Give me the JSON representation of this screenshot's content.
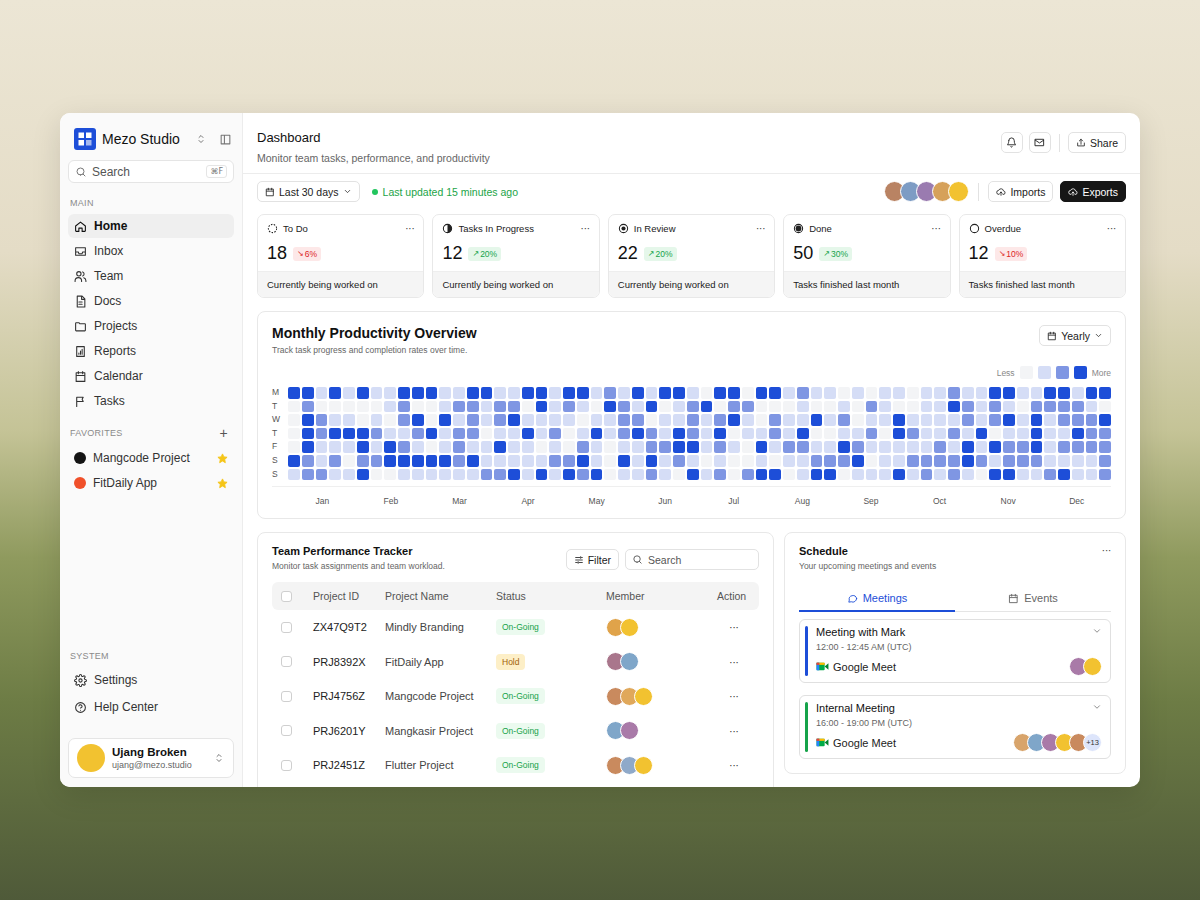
{
  "app": {
    "name": "Mezo Studio"
  },
  "search": {
    "placeholder": "Search",
    "shortcut": "⌘F"
  },
  "main_nav": {
    "label": "MAIN",
    "items": [
      {
        "label": "Home",
        "selected": true
      },
      {
        "label": "Inbox",
        "selected": false
      },
      {
        "label": "Team",
        "selected": false
      },
      {
        "label": "Docs",
        "selected": false
      },
      {
        "label": "Projects",
        "selected": false
      },
      {
        "label": "Reports",
        "selected": false
      },
      {
        "label": "Calendar",
        "selected": false
      },
      {
        "label": "Tasks",
        "selected": false
      }
    ]
  },
  "favorites": {
    "label": "FAVORITES",
    "add": "+",
    "items": [
      {
        "label": "Mangcode Project",
        "color": "#141414",
        "starred": true,
        "selected": false
      },
      {
        "label": "FitDaily App",
        "color": "#f0502a",
        "starred": true,
        "selected": false
      }
    ]
  },
  "system_nav": {
    "label": "SYSTEM",
    "items": [
      {
        "label": "Settings",
        "selected": false
      },
      {
        "label": "Help Center",
        "selected": false
      }
    ]
  },
  "user": {
    "name": "Ujang Broken",
    "email": "ujang@mezo.studio",
    "avatar_color": "#f2c230"
  },
  "header": {
    "title": "Dashboard",
    "subtitle": "Monitor team tasks, performance, and productivity",
    "share": "Share"
  },
  "toolbar": {
    "range": "Last 30 days",
    "updated": "Last updated 15 minutes ago",
    "avatars": [
      {
        "color": "#b98363"
      },
      {
        "color": "#7d9cc4"
      },
      {
        "color": "#9a7bb0"
      },
      {
        "color": "#d6a15a"
      },
      {
        "color": "#f2c230"
      }
    ],
    "imports": "Imports",
    "exports": "Exports"
  },
  "stats": [
    {
      "kind": "todo",
      "label": "To Do",
      "more": "···",
      "value": "18",
      "trend": "down",
      "arrow": "↘",
      "change": "6%",
      "note": "Currently being worked on"
    },
    {
      "kind": "progress",
      "label": "Tasks In Progress",
      "more": "···",
      "value": "12",
      "trend": "up",
      "arrow": "↗",
      "change": "20%",
      "note": "Currently being worked on"
    },
    {
      "kind": "review",
      "label": "In Review",
      "more": "···",
      "value": "22",
      "trend": "up",
      "arrow": "↗",
      "change": "20%",
      "note": "Currently being worked on"
    },
    {
      "kind": "done",
      "label": "Done",
      "more": "···",
      "value": "50",
      "trend": "up",
      "arrow": "↗",
      "change": "30%",
      "note": "Tasks finished last month"
    },
    {
      "kind": "overdue",
      "label": "Overdue",
      "more": "···",
      "value": "12",
      "trend": "down",
      "arrow": "↘",
      "change": "10%",
      "note": "Tasks finished last month"
    }
  ],
  "productivity": {
    "title": "Monthly Productivity Overview",
    "subtitle": "Track task progress and completion rates over time.",
    "period": "Yearly",
    "legend": {
      "less": "Less",
      "more": "More"
    },
    "days": [
      "M",
      "T",
      "W",
      "T",
      "F",
      "S",
      "S"
    ],
    "months": [
      "Jan",
      "Feb",
      "Mar",
      "Apr",
      "May",
      "Jun",
      "Jul",
      "Aug",
      "Sep",
      "Oct",
      "Nov",
      "Dec"
    ],
    "levels": [
      [
        3,
        3,
        1,
        3,
        1,
        3,
        1,
        1,
        3,
        3,
        3,
        1,
        1,
        3,
        3,
        1,
        1,
        3,
        3,
        1,
        3,
        3,
        1,
        2,
        1,
        3,
        1,
        3,
        3,
        1,
        0,
        3,
        3,
        0,
        3,
        3,
        1,
        2,
        1,
        1,
        0,
        1,
        0,
        1,
        1,
        0,
        1,
        1,
        2,
        1,
        1,
        3,
        3,
        1,
        1,
        3,
        3,
        1,
        3,
        3
      ],
      [
        0,
        2,
        0,
        0,
        0,
        0,
        0,
        1,
        2,
        0,
        0,
        1,
        2,
        2,
        1,
        2,
        2,
        0,
        3,
        1,
        2,
        1,
        0,
        3,
        2,
        1,
        3,
        0,
        1,
        2,
        3,
        0,
        2,
        2,
        0,
        0,
        0,
        1,
        0,
        0,
        1,
        0,
        2,
        1,
        0,
        0,
        1,
        1,
        3,
        2,
        1,
        2,
        1,
        0,
        2,
        2,
        2,
        2,
        1,
        0
      ],
      [
        0,
        3,
        2,
        1,
        1,
        0,
        1,
        0,
        2,
        3,
        0,
        3,
        1,
        2,
        1,
        2,
        3,
        1,
        1,
        1,
        1,
        0,
        1,
        1,
        2,
        2,
        0,
        1,
        1,
        2,
        1,
        2,
        3,
        1,
        0,
        2,
        1,
        1,
        3,
        1,
        2,
        0,
        1,
        1,
        3,
        1,
        1,
        1,
        1,
        2,
        1,
        2,
        3,
        1,
        3,
        1,
        2,
        2,
        2,
        3
      ],
      [
        0,
        3,
        2,
        3,
        3,
        3,
        2,
        1,
        1,
        2,
        3,
        1,
        2,
        2,
        0,
        1,
        1,
        3,
        1,
        2,
        0,
        1,
        3,
        1,
        2,
        3,
        2,
        1,
        3,
        2,
        1,
        3,
        0,
        1,
        1,
        2,
        1,
        3,
        0,
        0,
        1,
        1,
        2,
        0,
        3,
        2,
        1,
        1,
        2,
        1,
        3,
        0,
        1,
        1,
        3,
        1,
        1,
        3,
        2,
        2
      ],
      [
        0,
        3,
        1,
        1,
        1,
        3,
        1,
        3,
        2,
        1,
        0,
        1,
        2,
        1,
        1,
        3,
        1,
        1,
        0,
        1,
        0,
        2,
        1,
        0,
        1,
        1,
        2,
        2,
        3,
        3,
        1,
        2,
        1,
        0,
        3,
        1,
        2,
        2,
        1,
        1,
        3,
        2,
        1,
        1,
        1,
        1,
        1,
        2,
        1,
        3,
        1,
        3,
        2,
        2,
        3,
        1,
        2,
        2,
        2,
        2
      ],
      [
        3,
        2,
        1,
        2,
        0,
        2,
        2,
        3,
        3,
        3,
        3,
        3,
        2,
        3,
        1,
        1,
        1,
        1,
        1,
        2,
        2,
        3,
        1,
        0,
        3,
        1,
        3,
        1,
        2,
        1,
        0,
        1,
        0,
        0,
        1,
        0,
        1,
        1,
        2,
        2,
        2,
        3,
        0,
        1,
        1,
        2,
        2,
        2,
        2,
        3,
        2,
        1,
        2,
        2,
        2,
        1,
        1,
        1,
        1,
        2
      ],
      [
        1,
        2,
        2,
        1,
        1,
        3,
        0,
        0,
        1,
        1,
        1,
        1,
        1,
        1,
        2,
        2,
        3,
        1,
        3,
        1,
        3,
        2,
        3,
        0,
        1,
        1,
        2,
        1,
        0,
        3,
        1,
        2,
        0,
        2,
        3,
        3,
        0,
        1,
        3,
        3,
        0,
        1,
        1,
        1,
        3,
        1,
        2,
        1,
        2,
        1,
        0,
        3,
        3,
        1,
        1,
        2,
        3,
        1,
        1,
        2
      ]
    ]
  },
  "team": {
    "title": "Team Performance Tracker",
    "subtitle": "Monitor task assignments and team workload.",
    "filter": "Filter",
    "search": "Search",
    "columns": [
      "Project ID",
      "Project Name",
      "Status",
      "Member",
      "Action"
    ],
    "rows": [
      {
        "id": "ZX47Q9T2",
        "name": "Mindly Branding",
        "status": "On-Going",
        "status_kind": "ongoing",
        "checked": false,
        "action": "···",
        "members": [
          {
            "color": "#e0a34a"
          },
          {
            "color": "#f2c230"
          }
        ]
      },
      {
        "id": "PRJ8392X",
        "name": "FitDaily App",
        "status": "Hold",
        "status_kind": "hold",
        "checked": false,
        "action": "···",
        "members": [
          {
            "color": "#a9768c"
          },
          {
            "color": "#7fa6c9"
          }
        ]
      },
      {
        "id": "PRJ4756Z",
        "name": "Mangcode Project",
        "status": "On-Going",
        "status_kind": "ongoing",
        "checked": false,
        "action": "···",
        "members": [
          {
            "color": "#c98a5e"
          },
          {
            "color": "#e0a85b"
          },
          {
            "color": "#f2c230"
          }
        ]
      },
      {
        "id": "PRJ6201Y",
        "name": "Mangkasir Project",
        "status": "On-Going",
        "status_kind": "ongoing",
        "checked": false,
        "action": "···",
        "members": [
          {
            "color": "#7fa6c9"
          },
          {
            "color": "#a97aa8"
          }
        ]
      },
      {
        "id": "PRJ2451Z",
        "name": "Flutter Project",
        "status": "On-Going",
        "status_kind": "ongoing",
        "checked": false,
        "action": "···",
        "members": [
          {
            "color": "#c98a5e"
          },
          {
            "color": "#8fa9c9"
          },
          {
            "color": "#f2c230"
          }
        ]
      }
    ]
  },
  "schedule": {
    "title": "Schedule",
    "subtitle": "Your upcoming meetings and events",
    "more": "···",
    "tabs": [
      {
        "label": "Meetings",
        "selected": true
      },
      {
        "label": "Events",
        "selected": false
      }
    ],
    "items": [
      {
        "title": "Meeting with Mark",
        "time": "12:00 - 12:45 AM (UTC)",
        "platform": "Google Meet",
        "color": "#1d4ed8",
        "expanded": false,
        "extra": "",
        "attendees": [
          {
            "color": "#a97aa8"
          },
          {
            "color": "#f2c230"
          }
        ]
      },
      {
        "title": "Internal Meeting",
        "time": "16:00 - 19:00 PM (UTC)",
        "platform": "Google Meet",
        "color": "#16a34a",
        "expanded": false,
        "extra": "+13",
        "attendees": [
          {
            "color": "#d8a46b"
          },
          {
            "color": "#7fa6c9"
          },
          {
            "color": "#a97aa8"
          },
          {
            "color": "#f2c230"
          },
          {
            "color": "#c98a5e"
          }
        ]
      }
    ]
  }
}
